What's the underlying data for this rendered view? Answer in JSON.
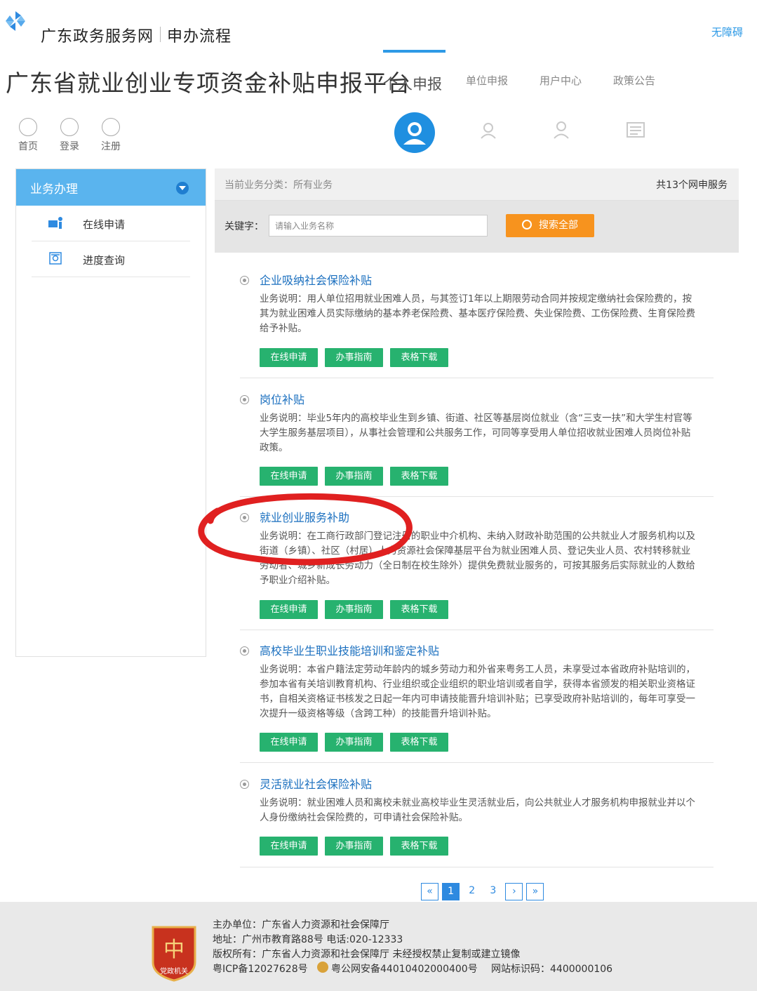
{
  "header": {
    "site_name": "广东政务服务网",
    "section": "申办流程",
    "accessibility": "无障碍",
    "platform_title": "广东省就业创业专项资金补贴申报平台",
    "tabs": [
      {
        "label": "个人申报",
        "active": true
      },
      {
        "label": "单位申报",
        "active": false
      },
      {
        "label": "用户中心",
        "active": false
      },
      {
        "label": "政策公告",
        "active": false
      }
    ],
    "quick_links": [
      {
        "label": "首页",
        "icon": "home-icon"
      },
      {
        "label": "登录",
        "icon": "lock-icon"
      },
      {
        "label": "注册",
        "icon": "edit-icon"
      }
    ]
  },
  "sidebar": {
    "title": "业务办理",
    "items": [
      {
        "label": "在线申请",
        "icon": "apply-icon"
      },
      {
        "label": "进度查询",
        "icon": "query-icon"
      }
    ]
  },
  "main": {
    "category_label": "当前业务分类：所有业务",
    "count_label": "共13个网申服务",
    "keyword_label": "关键字：",
    "search_placeholder": "请输入业务名称",
    "search_button": "搜索全部",
    "services": [
      {
        "title": "企业吸纳社会保险补贴",
        "description": "业务说明：用人单位招用就业困难人员，与其签订1年以上期限劳动合同并按规定缴纳社会保险费的，按其为就业困难人员实际缴纳的基本养老保险费、基本医疗保险费、失业保险费、工伤保险费、生育保险费给予补贴。"
      },
      {
        "title": "岗位补贴",
        "description": "业务说明：毕业5年内的高校毕业生到乡镇、街道、社区等基层岗位就业（含“三支一扶”和大学生村官等大学生服务基层项目），从事社会管理和公共服务工作，可同等享受用人单位招收就业困难人员岗位补贴政策。"
      },
      {
        "title": "就业创业服务补助",
        "description": "业务说明：在工商行政部门登记注册的职业中介机构、未纳入财政补助范围的公共就业人才服务机构以及街道（乡镇）、社区（村居）人力资源社会保障基层平台为就业困难人员、登记失业人员、农村转移就业劳动者、城乡新成长劳动力（全日制在校生除外）提供免费就业服务的，可按其服务后实际就业的人数给予职业介绍补贴。"
      },
      {
        "title": "高校毕业生职业技能培训和鉴定补贴",
        "description": "业务说明：本省户籍法定劳动年龄内的城乡劳动力和外省来粤务工人员，未享受过本省政府补贴培训的，参加本省有关培训教育机构、行业组织或企业组织的职业培训或者自学，获得本省颁发的相关职业资格证书，自相关资格证书核发之日起一年内可申请技能晋升培训补贴；已享受政府补贴培训的，每年可享受一次提升一级资格等级（含跨工种）的技能晋升培训补贴。"
      },
      {
        "title": "灵活就业社会保险补贴",
        "description": "业务说明：就业困难人员和离校未就业高校毕业生灵活就业后，向公共就业人才服务机构申报就业并以个人身份缴纳社会保险费的，可申请社会保险补贴。"
      }
    ],
    "service_buttons": {
      "apply": "在线申请",
      "guide": "办事指南",
      "download": "表格下载"
    },
    "pager": {
      "first": "«",
      "pages": [
        "1",
        "2",
        "3"
      ],
      "current": "1",
      "next": "›",
      "last": "»"
    }
  },
  "footer": {
    "sponsor": "主办单位：广东省人力资源和社会保障厅",
    "address": "地址：广州市教育路88号 电话:020-12333",
    "copyright": "版权所有：广东省人力资源和社会保障厅 未经授权禁止复制或建立镜像",
    "icp": "粤ICP备12027628号",
    "police": "粤公网安备44010402000400号",
    "site_code": "网站标识码：4400000106",
    "emblem_text": "党政机关"
  },
  "colors": {
    "accent": "#2e9ae6",
    "search_button": "#f7931e",
    "green_button": "#27b26f",
    "annotation": "#e02020"
  }
}
